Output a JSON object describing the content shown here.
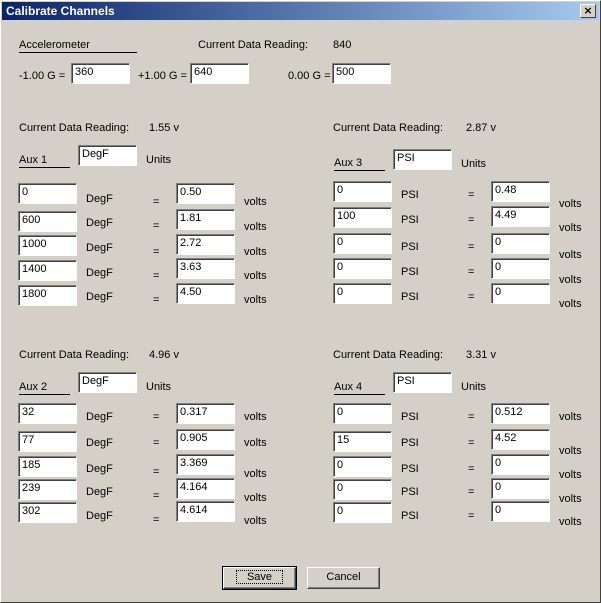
{
  "window": {
    "title": "Calibrate Channels",
    "close_symbol": "×"
  },
  "accel": {
    "label": "Accelerometer",
    "reading_label": "Current Data Reading:",
    "reading_value": "840",
    "neg_label": "-1.00 G =",
    "neg_value": "360",
    "pos_label": "+1.00 G =",
    "pos_value": "640",
    "zero_label": "0.00 G =",
    "zero_value": "500"
  },
  "aux1": {
    "reading_label": "Current Data Reading:",
    "reading_value": "1.55 v",
    "name": "Aux 1",
    "unit": "DegF",
    "units_label": "Units",
    "rows": [
      {
        "input": "0",
        "unit": "DegF",
        "eq": "=",
        "volts": "0.50",
        "vlabel": "volts"
      },
      {
        "input": "600",
        "unit": "DegF",
        "eq": "=",
        "volts": "1.81",
        "vlabel": "volts"
      },
      {
        "input": "1000",
        "unit": "DegF",
        "eq": "=",
        "volts": "2.72",
        "vlabel": "volts"
      },
      {
        "input": "1400",
        "unit": "DegF",
        "eq": "=",
        "volts": "3.63",
        "vlabel": "volts"
      },
      {
        "input": "1800",
        "unit": "DegF",
        "eq": "=",
        "volts": "4.50",
        "vlabel": "volts"
      }
    ]
  },
  "aux3": {
    "reading_label": "Current Data Reading:",
    "reading_value": "2.87 v",
    "name": "Aux 3",
    "unit": "PSI",
    "units_label": "Units",
    "rows": [
      {
        "input": "0",
        "unit": "PSI",
        "eq": "=",
        "volts": "0.48",
        "vlabel": "volts"
      },
      {
        "input": "100",
        "unit": "PSI",
        "eq": "=",
        "volts": "4.49",
        "vlabel": "volts"
      },
      {
        "input": "0",
        "unit": "PSI",
        "eq": "=",
        "volts": "0",
        "vlabel": "volts"
      },
      {
        "input": "0",
        "unit": "PSI",
        "eq": "=",
        "volts": "0",
        "vlabel": "volts"
      },
      {
        "input": "0",
        "unit": "PSI",
        "eq": "=",
        "volts": "0",
        "vlabel": "volts"
      }
    ]
  },
  "aux2": {
    "reading_label": "Current Data Reading:",
    "reading_value": "4.96 v",
    "name": "Aux 2",
    "unit": "DegF",
    "units_label": "Units",
    "rows": [
      {
        "input": "32",
        "unit": "DegF",
        "eq": "=",
        "volts": "0.317",
        "vlabel": "volts"
      },
      {
        "input": "77",
        "unit": "DegF",
        "eq": "=",
        "volts": "0.905",
        "vlabel": "volts"
      },
      {
        "input": "185",
        "unit": "DegF",
        "eq": "=",
        "volts": "3.369",
        "vlabel": "volts"
      },
      {
        "input": "239",
        "unit": "DegF",
        "eq": "=",
        "volts": "4.164",
        "vlabel": "volts"
      },
      {
        "input": "302",
        "unit": "DegF",
        "eq": "=",
        "volts": "4.614",
        "vlabel": "volts"
      }
    ]
  },
  "aux4": {
    "reading_label": "Current Data Reading:",
    "reading_value": "3.31 v",
    "name": "Aux 4",
    "unit": "PSI",
    "units_label": "Units",
    "rows": [
      {
        "input": "0",
        "unit": "PSI",
        "eq": "=",
        "volts": "0.512",
        "vlabel": "volts"
      },
      {
        "input": "15",
        "unit": "PSI",
        "eq": "=",
        "volts": "4.52",
        "vlabel": "volts"
      },
      {
        "input": "0",
        "unit": "PSI",
        "eq": "=",
        "volts": "0",
        "vlabel": "volts"
      },
      {
        "input": "0",
        "unit": "PSI",
        "eq": "=",
        "volts": "0",
        "vlabel": "volts"
      },
      {
        "input": "0",
        "unit": "PSI",
        "eq": "=",
        "volts": "0",
        "vlabel": "volts"
      }
    ]
  },
  "buttons": {
    "save": "Save",
    "cancel": "Cancel"
  }
}
